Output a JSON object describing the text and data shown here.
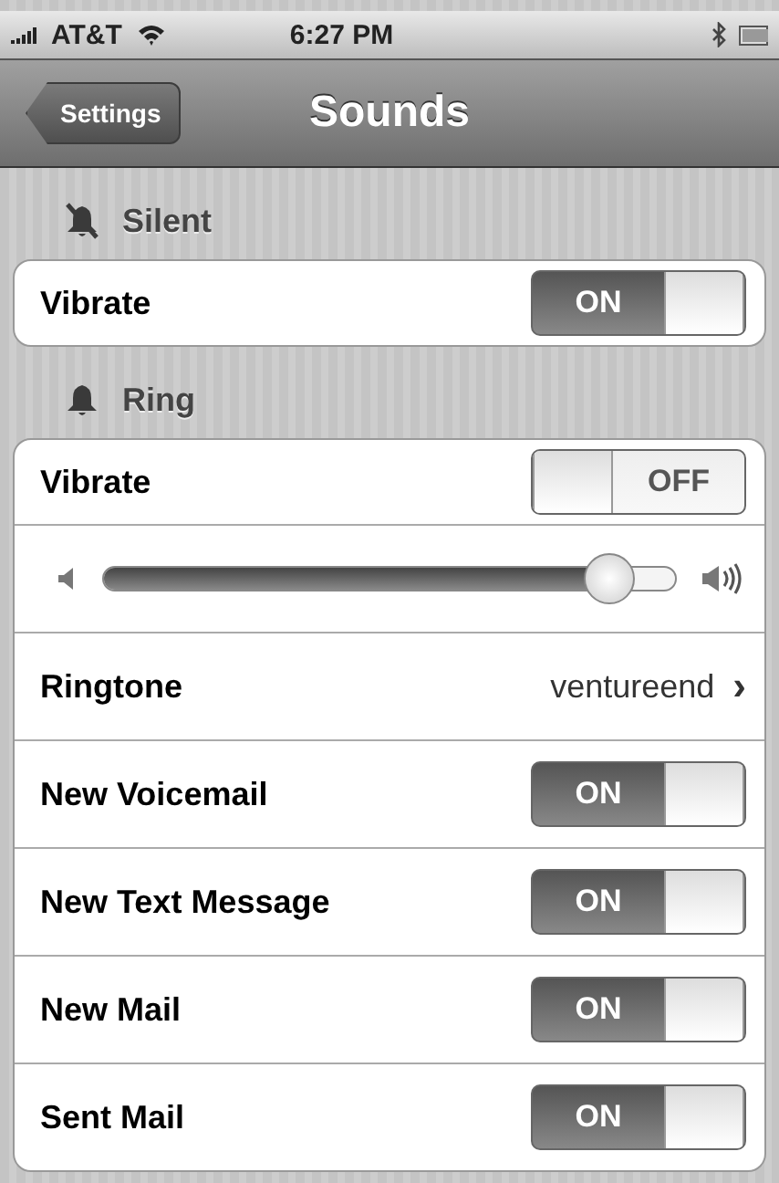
{
  "status_bar": {
    "carrier": "AT&T",
    "time": "6:27 PM"
  },
  "nav": {
    "back": "Settings",
    "title": "Sounds"
  },
  "sections": [
    {
      "header": "Silent",
      "muted": true,
      "rows": [
        {
          "kind": "switch",
          "label": "Vibrate",
          "on": true,
          "on_text": "ON"
        }
      ]
    },
    {
      "header": "Ring",
      "muted": false,
      "rows": [
        {
          "kind": "switch",
          "label": "Vibrate",
          "on": false,
          "off_text": "OFF"
        },
        {
          "kind": "slider",
          "level": 0.88
        },
        {
          "kind": "link",
          "label": "Ringtone",
          "value": "ventureend",
          "chevron": "›"
        },
        {
          "kind": "switch",
          "label": "New Voicemail",
          "on": true,
          "on_text": "ON"
        },
        {
          "kind": "switch",
          "label": "New Text Message",
          "on": true,
          "on_text": "ON"
        },
        {
          "kind": "switch",
          "label": "New Mail",
          "on": true,
          "on_text": "ON"
        },
        {
          "kind": "switch",
          "label": "Sent Mail",
          "on": true,
          "on_text": "ON"
        }
      ]
    }
  ]
}
